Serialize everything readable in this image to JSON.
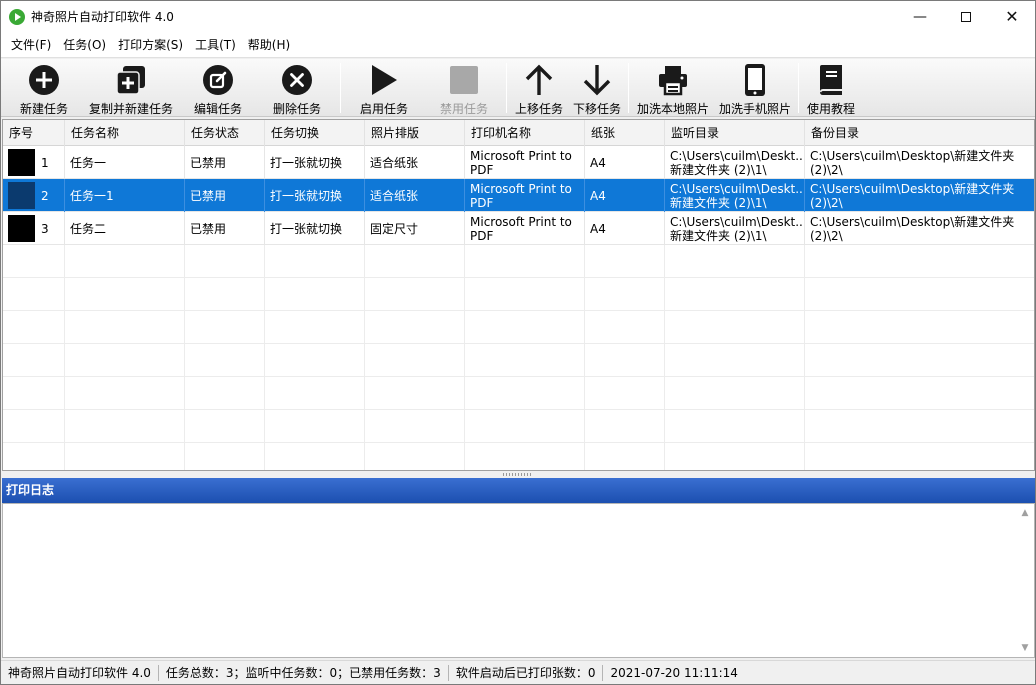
{
  "window": {
    "title": "神奇照片自动打印软件 4.0"
  },
  "menu": [
    "文件(F)",
    "任务(O)",
    "打印方案(S)",
    "工具(T)",
    "帮助(H)"
  ],
  "toolbar": {
    "new_task": "新建任务",
    "copy_new_task": "复制并新建任务",
    "edit_task": "编辑任务",
    "delete_task": "删除任务",
    "enable_task": "启用任务",
    "disable_task": "禁用任务",
    "move_up": "上移任务",
    "move_down": "下移任务",
    "local_photos": "加洗本地照片",
    "phone_photos": "加洗手机照片",
    "tutorial": "使用教程"
  },
  "table": {
    "columns": [
      "序号",
      "任务名称",
      "任务状态",
      "任务切换",
      "照片排版",
      "打印机名称",
      "纸张",
      "监听目录",
      "备份目录"
    ],
    "rows": [
      {
        "index": "1",
        "name": "任务一",
        "status": "已禁用",
        "switch": "打一张就切换",
        "layout": "适合纸张",
        "printer_l1": "Microsoft Print to",
        "printer_l2": "PDF",
        "paper": "A4",
        "watch_l1": "C:\\Users\\cuilm\\Deskt...",
        "watch_l2": "新建文件夹 (2)\\1\\",
        "backup_l1": "C:\\Users\\cuilm\\Desktop\\新建文件夹",
        "backup_l2": "(2)\\2\\"
      },
      {
        "index": "2",
        "name": "任务一1",
        "status": "已禁用",
        "switch": "打一张就切换",
        "layout": "适合纸张",
        "printer_l1": "Microsoft Print to",
        "printer_l2": "PDF",
        "paper": "A4",
        "watch_l1": "C:\\Users\\cuilm\\Deskt...",
        "watch_l2": "新建文件夹 (2)\\1\\",
        "backup_l1": "C:\\Users\\cuilm\\Desktop\\新建文件夹",
        "backup_l2": "(2)\\2\\"
      },
      {
        "index": "3",
        "name": "任务二",
        "status": "已禁用",
        "switch": "打一张就切换",
        "layout": "固定尺寸",
        "printer_l1": "Microsoft Print to",
        "printer_l2": "PDF",
        "paper": "A4",
        "watch_l1": "C:\\Users\\cuilm\\Deskt...",
        "watch_l2": "新建文件夹 (2)\\1\\",
        "backup_l1": "C:\\Users\\cuilm\\Desktop\\新建文件夹",
        "backup_l2": "(2)\\2\\"
      }
    ]
  },
  "log": {
    "title": "打印日志"
  },
  "status": {
    "app": "神奇照片自动打印软件 4.0",
    "counts": "任务总数：3；监听中任务数：0；已禁用任务数：3",
    "printed": "软件启动后已打印张数：0",
    "time": "2021-07-20 11:11:14"
  }
}
